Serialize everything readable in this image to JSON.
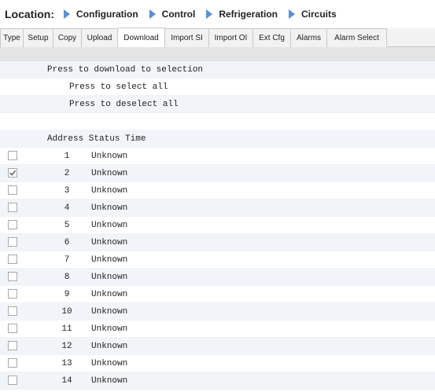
{
  "location": {
    "label": "Location:",
    "crumbs": [
      "Configuration",
      "Control",
      "Refrigeration",
      "Circuits"
    ]
  },
  "tabs": [
    {
      "label": "Type",
      "active": false
    },
    {
      "label": "Setup",
      "active": false
    },
    {
      "label": "Copy",
      "active": false
    },
    {
      "label": "Upload",
      "active": false
    },
    {
      "label": "Download",
      "active": true
    },
    {
      "label": "Import SI",
      "active": false
    },
    {
      "label": "Import OI",
      "active": false
    },
    {
      "label": "Ext Cfg",
      "active": false
    },
    {
      "label": "Alarms",
      "active": false
    },
    {
      "label": "Alarm Select",
      "active": false
    }
  ],
  "actions": {
    "download": "Press to download to selection",
    "select_all": "Press to select all",
    "deselect_all": "Press to deselect all"
  },
  "table": {
    "header": "Address Status Time",
    "rows": [
      {
        "address": "1",
        "status": "Unknown",
        "checked": false
      },
      {
        "address": "2",
        "status": "Unknown",
        "checked": true
      },
      {
        "address": "3",
        "status": "Unknown",
        "checked": false
      },
      {
        "address": "4",
        "status": "Unknown",
        "checked": false
      },
      {
        "address": "5",
        "status": "Unknown",
        "checked": false
      },
      {
        "address": "6",
        "status": "Unknown",
        "checked": false
      },
      {
        "address": "7",
        "status": "Unknown",
        "checked": false
      },
      {
        "address": "8",
        "status": "Unknown",
        "checked": false
      },
      {
        "address": "9",
        "status": "Unknown",
        "checked": false
      },
      {
        "address": "10",
        "status": "Unknown",
        "checked": false
      },
      {
        "address": "11",
        "status": "Unknown",
        "checked": false
      },
      {
        "address": "12",
        "status": "Unknown",
        "checked": false
      },
      {
        "address": "13",
        "status": "Unknown",
        "checked": false
      },
      {
        "address": "14",
        "status": "Unknown",
        "checked": false
      }
    ]
  },
  "colors": {
    "arrow": "#5b8fd4",
    "row_shade": "#f1f5f9",
    "strip": "#e4e4e4"
  }
}
